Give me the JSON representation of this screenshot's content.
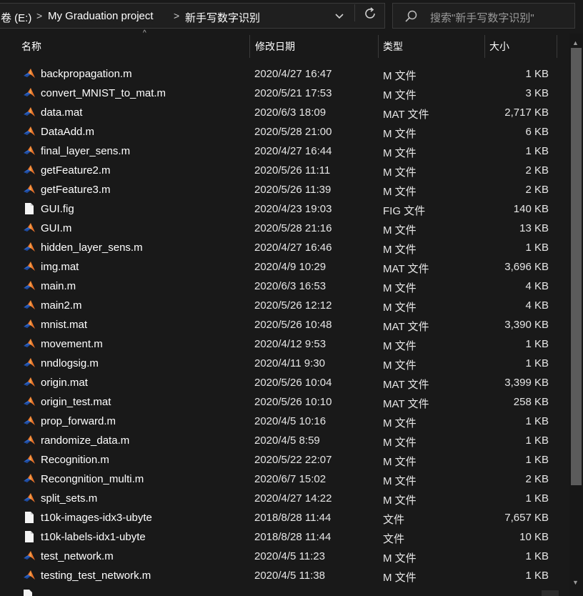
{
  "address": {
    "crumbs": [
      "卷 (E:)",
      "My Graduation project",
      "新手写数字识别"
    ],
    "separator": ">"
  },
  "search": {
    "placeholder": "搜索\"新手写数字识别\""
  },
  "columns": {
    "name": "名称",
    "date": "修改日期",
    "type": "类型",
    "size": "大小"
  },
  "files": [
    {
      "name": "backpropagation.m",
      "date": "2020/4/27 16:47",
      "type": "M 文件",
      "size": "1 KB",
      "icon": "matlab-file-icon"
    },
    {
      "name": "convert_MNIST_to_mat.m",
      "date": "2020/5/21 17:53",
      "type": "M 文件",
      "size": "3 KB",
      "icon": "matlab-file-icon"
    },
    {
      "name": "data.mat",
      "date": "2020/6/3 18:09",
      "type": "MAT 文件",
      "size": "2,717 KB",
      "icon": "matlab-file-icon"
    },
    {
      "name": "DataAdd.m",
      "date": "2020/5/28 21:00",
      "type": "M 文件",
      "size": "6 KB",
      "icon": "matlab-file-icon"
    },
    {
      "name": "final_layer_sens.m",
      "date": "2020/4/27 16:44",
      "type": "M 文件",
      "size": "1 KB",
      "icon": "matlab-file-icon"
    },
    {
      "name": "getFeature2.m",
      "date": "2020/5/26 11:11",
      "type": "M 文件",
      "size": "2 KB",
      "icon": "matlab-file-icon"
    },
    {
      "name": "getFeature3.m",
      "date": "2020/5/26 11:39",
      "type": "M 文件",
      "size": "2 KB",
      "icon": "matlab-file-icon"
    },
    {
      "name": "GUI.fig",
      "date": "2020/4/23 19:03",
      "type": "FIG 文件",
      "size": "140 KB",
      "icon": "blank-file-icon"
    },
    {
      "name": "GUI.m",
      "date": "2020/5/28 21:16",
      "type": "M 文件",
      "size": "13 KB",
      "icon": "matlab-file-icon"
    },
    {
      "name": "hidden_layer_sens.m",
      "date": "2020/4/27 16:46",
      "type": "M 文件",
      "size": "1 KB",
      "icon": "matlab-file-icon"
    },
    {
      "name": "img.mat",
      "date": "2020/4/9 10:29",
      "type": "MAT 文件",
      "size": "3,696 KB",
      "icon": "matlab-file-icon"
    },
    {
      "name": "main.m",
      "date": "2020/6/3 16:53",
      "type": "M 文件",
      "size": "4 KB",
      "icon": "matlab-file-icon"
    },
    {
      "name": "main2.m",
      "date": "2020/5/26 12:12",
      "type": "M 文件",
      "size": "4 KB",
      "icon": "matlab-file-icon"
    },
    {
      "name": "mnist.mat",
      "date": "2020/5/26 10:48",
      "type": "MAT 文件",
      "size": "3,390 KB",
      "icon": "matlab-file-icon"
    },
    {
      "name": "movement.m",
      "date": "2020/4/12 9:53",
      "type": "M 文件",
      "size": "1 KB",
      "icon": "matlab-file-icon"
    },
    {
      "name": "nndlogsig.m",
      "date": "2020/4/11 9:30",
      "type": "M 文件",
      "size": "1 KB",
      "icon": "matlab-file-icon"
    },
    {
      "name": "origin.mat",
      "date": "2020/5/26 10:04",
      "type": "MAT 文件",
      "size": "3,399 KB",
      "icon": "matlab-file-icon"
    },
    {
      "name": "origin_test.mat",
      "date": "2020/5/26 10:10",
      "type": "MAT 文件",
      "size": "258 KB",
      "icon": "matlab-file-icon"
    },
    {
      "name": "prop_forward.m",
      "date": "2020/4/5 10:16",
      "type": "M 文件",
      "size": "1 KB",
      "icon": "matlab-file-icon"
    },
    {
      "name": "randomize_data.m",
      "date": "2020/4/5 8:59",
      "type": "M 文件",
      "size": "1 KB",
      "icon": "matlab-file-icon"
    },
    {
      "name": "Recognition.m",
      "date": "2020/5/22 22:07",
      "type": "M 文件",
      "size": "1 KB",
      "icon": "matlab-file-icon"
    },
    {
      "name": "Recongnition_multi.m",
      "date": "2020/6/7 15:02",
      "type": "M 文件",
      "size": "2 KB",
      "icon": "matlab-file-icon"
    },
    {
      "name": "split_sets.m",
      "date": "2020/4/27 14:22",
      "type": "M 文件",
      "size": "1 KB",
      "icon": "matlab-file-icon"
    },
    {
      "name": "t10k-images-idx3-ubyte",
      "date": "2018/8/28 11:44",
      "type": "文件",
      "size": "7,657 KB",
      "icon": "blank-file-icon"
    },
    {
      "name": "t10k-labels-idx1-ubyte",
      "date": "2018/8/28 11:44",
      "type": "文件",
      "size": "10 KB",
      "icon": "blank-file-icon"
    },
    {
      "name": "test_network.m",
      "date": "2020/4/5 11:23",
      "type": "M 文件",
      "size": "1 KB",
      "icon": "matlab-file-icon"
    },
    {
      "name": "testing_test_network.m",
      "date": "2020/4/5 11:38",
      "type": "M 文件",
      "size": "1 KB",
      "icon": "matlab-file-icon"
    }
  ],
  "colors": {
    "background": "#191919",
    "matlab_orange": "#e8722a",
    "matlab_blue": "#2f66c9"
  }
}
